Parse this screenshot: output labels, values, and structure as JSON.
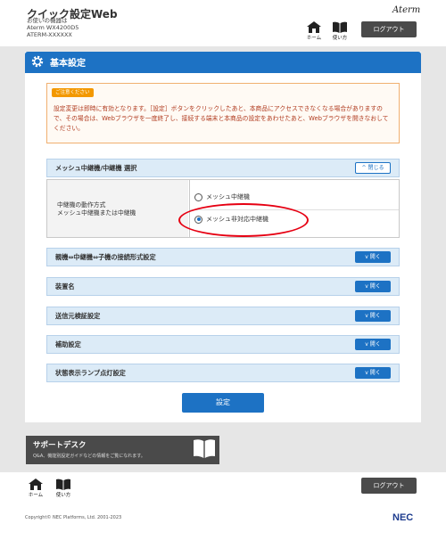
{
  "header": {
    "app_title": "クイック設定Web",
    "device_label": "お使いの機器は",
    "device_model": "Aterm WX4200D5",
    "device_id": "ATERM-XXXXXX",
    "brand": "Aterm",
    "home_label": "ホーム",
    "help_label": "使い方",
    "logout_label": "ログアウト"
  },
  "panel": {
    "title": "基本設定",
    "caution_badge": "ご注意ください",
    "caution_text": "設定変更は即時に有効となります。［設定］ボタンをクリックしたあと、本商品にアクセスできなくなる場合がありますので、その場合は、Webブラウザを一度終了し、接続する端末と本商品の設定をあわせたあと、Webブラウザを開きなおしてください。"
  },
  "mesh_section": {
    "label": "メッシュ中継機/中継機 選択",
    "toggle_label": "閉じる",
    "row_label_line1": "中継機の動作方式",
    "row_label_line2": "メッシュ中継機または中継機",
    "options": [
      {
        "label": "メッシュ中継機",
        "selected": false
      },
      {
        "label": "メッシュ非対応中継機",
        "selected": true
      }
    ]
  },
  "sections": [
    {
      "label": "親機⇔中継機⇔子機の接続形式設定",
      "toggle_label": "開く"
    },
    {
      "label": "装置名",
      "toggle_label": "開く"
    },
    {
      "label": "送信元検証設定",
      "toggle_label": "開く"
    },
    {
      "label": "補助設定",
      "toggle_label": "開く"
    },
    {
      "label": "状態表示ランプ点灯設定",
      "toggle_label": "開く"
    }
  ],
  "set_button_label": "設定",
  "support": {
    "title": "サポートデスク",
    "subtitle": "Q&A、機能別設定ガイドなどの情報をご覧になれます。"
  },
  "footer": {
    "home_label": "ホーム",
    "help_label": "使い方",
    "logout_label": "ログアウト",
    "copyright": "Copyright© NEC Platforms, Ltd. 2001-2023",
    "brand": "NEC"
  },
  "colors": {
    "accent": "#1d72c4",
    "section_bg": "#dcebf7",
    "caution": "#f39800",
    "highlight": "#e60012",
    "dark_button": "#4a4a4a"
  }
}
